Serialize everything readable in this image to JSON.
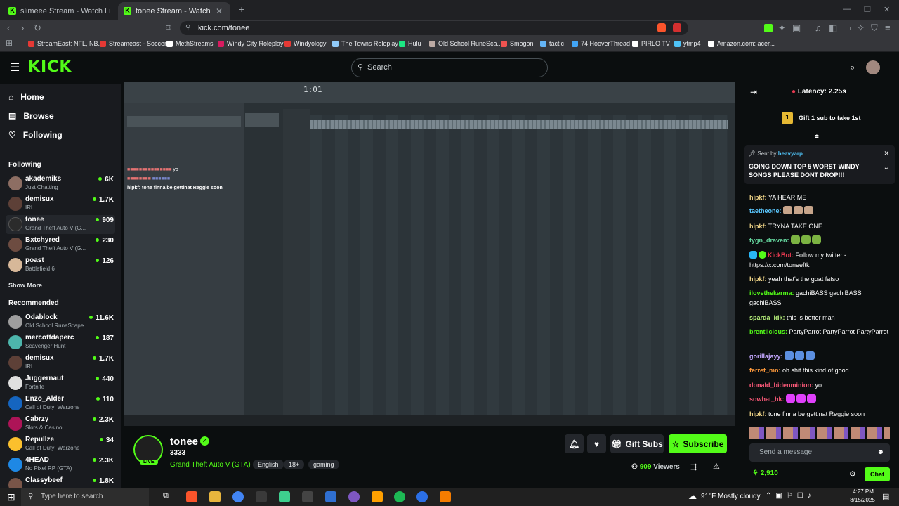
{
  "browser": {
    "tabs": [
      {
        "title": "slimeee Stream - Watch Live on Kick",
        "active": false
      },
      {
        "title": "tonee Stream - Watch Live on Kick",
        "active": true
      }
    ],
    "url": "kick.com/tonee",
    "bookmarks": [
      {
        "label": "StreamEast: NFL, NB...",
        "color": "#e53935"
      },
      {
        "label": "Streameast - Soccer",
        "color": "#e53935"
      },
      {
        "label": "MethStreams",
        "color": "#ffffff"
      },
      {
        "label": "Windy City Roleplay",
        "color": "#d81b60"
      },
      {
        "label": "Windyology",
        "color": "#e53935"
      },
      {
        "label": "The Towns Roleplay",
        "color": "#90caf9"
      },
      {
        "label": "Hulu",
        "color": "#1ce783"
      },
      {
        "label": "Old School RuneSca...",
        "color": "#bcaaa4"
      },
      {
        "label": "Smogon",
        "color": "#ef5350"
      },
      {
        "label": "tactic",
        "color": "#64b5f6"
      },
      {
        "label": "74 HooverThread",
        "color": "#42a5f5"
      },
      {
        "label": "PIRLO TV",
        "color": "#ffffff"
      },
      {
        "label": "ytmp4",
        "color": "#4fc3f7"
      },
      {
        "label": "Amazon.com: acer...",
        "color": "#ffffff"
      }
    ]
  },
  "header": {
    "logo": "KICK",
    "search_placeholder": "Search"
  },
  "sidebar": {
    "nav": [
      {
        "label": "Home",
        "icon": "home-icon"
      },
      {
        "label": "Browse",
        "icon": "browse-icon"
      },
      {
        "label": "Following",
        "icon": "heart-icon"
      }
    ],
    "following_title": "Following",
    "following": [
      {
        "name": "akademiks",
        "game": "Just Chatting",
        "viewers": "6K",
        "color": "#8d6e63"
      },
      {
        "name": "demisux",
        "game": "IRL",
        "viewers": "1.7K",
        "color": "#5d4037"
      },
      {
        "name": "tonee",
        "game": "Grand Theft Auto V (G...",
        "viewers": "909",
        "color": "#2b2b2b"
      },
      {
        "name": "Bxtchyred",
        "game": "Grand Theft Auto V (G...",
        "viewers": "230",
        "color": "#6d4c41"
      },
      {
        "name": "poast",
        "game": "Battlefield 6",
        "viewers": "126",
        "color": "#d7b899"
      }
    ],
    "show_more": "Show More",
    "recommended_title": "Recommended",
    "recommended": [
      {
        "name": "Odablock",
        "game": "Old School RuneScape",
        "viewers": "11.6K",
        "color": "#9e9e9e"
      },
      {
        "name": "mercoffdaperc",
        "game": "Scavenger Hunt",
        "viewers": "187",
        "color": "#4db6ac"
      },
      {
        "name": "demisux",
        "game": "IRL",
        "viewers": "1.7K",
        "color": "#5d4037"
      },
      {
        "name": "Juggernaut",
        "game": "Fortnite",
        "viewers": "440",
        "color": "#e0e0e0"
      },
      {
        "name": "Enzo_Alder",
        "game": "Call of Duty: Warzone",
        "viewers": "110",
        "color": "#1565c0"
      },
      {
        "name": "Cabrzy",
        "game": "Slots & Casino",
        "viewers": "2.3K",
        "color": "#ad1457"
      },
      {
        "name": "Repullze",
        "game": "Call of Duty: Warzone",
        "viewers": "34",
        "color": "#fbc02d"
      },
      {
        "name": "4HEAD",
        "game": "No Pixel RP (GTA)",
        "viewers": "2.3K",
        "color": "#1e88e5"
      },
      {
        "name": "Classybeef",
        "game": "",
        "viewers": "1.8K",
        "color": "#795548"
      }
    ]
  },
  "video": {
    "overlay_chat": [
      {
        "user": "",
        "text": "yo"
      },
      {
        "user": "",
        "text": ""
      },
      {
        "user": "hipkf:",
        "text": "tone finna be gettinat Reggie soon"
      }
    ]
  },
  "stream": {
    "name": "tonee",
    "live": "LIVE",
    "title": "3333",
    "category": "Grand Theft Auto V (GTA)",
    "tags": [
      "English",
      "18+",
      "gaming"
    ],
    "gift_label": "Gift Subs",
    "subscribe_label": "Subscribe",
    "viewers": "909",
    "viewers_label": "Viewers"
  },
  "chat": {
    "latency": "Latency: 2.25s",
    "gift_count": "1",
    "gift_text": "Gift 1 sub to take 1st",
    "pinned_sent_by": "Sent by",
    "pinned_user": "heavyarp",
    "pinned_text": "GOING DOWN TOP 5 WORST WINDY SONGS PLEASE DONT DROP!!!",
    "messages": [
      {
        "user": "hipkf:",
        "color": "#f5d98a",
        "text": "YA HEAR ME",
        "emotes": 0
      },
      {
        "user": "taetheone:",
        "color": "#5bc8ff",
        "text": "",
        "emotes": 3
      },
      {
        "user": "hipkf:",
        "color": "#f5d98a",
        "text": "TRYNA TAKE ONE",
        "emotes": 0
      },
      {
        "user": "tygn_draven:",
        "color": "#66d9a0",
        "text": "",
        "emotes": 3
      },
      {
        "user": "KickBot:",
        "color": "#e53950",
        "text": "Follow my twitter - https://x.com/toneeftk",
        "emotes": 0
      },
      {
        "user": "hipkf:",
        "color": "#f5d98a",
        "text": "yeah that's the goat fatso",
        "emotes": 0
      },
      {
        "user": "ilovethekarma:",
        "color": "#53fc18",
        "text": "gachiBASS gachiBASS gachiBASS",
        "emotes": 0
      },
      {
        "user": "sparda_ldk:",
        "color": "#b9f27c",
        "text": "this is better man",
        "emotes": 0
      },
      {
        "user": "brentlicious:",
        "color": "#53fc18",
        "text": "PartyParrot PartyParrot PartyParrot",
        "emotes": 0
      },
      {
        "user": "gorillajayy:",
        "color": "#c4a7ff",
        "text": "",
        "emotes": 3
      },
      {
        "user": "ferret_mn:",
        "color": "#ff9a3c",
        "text": "oh shit this kind of good",
        "emotes": 0
      },
      {
        "user": "donald_bidenminion:",
        "color": "#ff5a7a",
        "text": "yo",
        "emotes": 0
      },
      {
        "user": "sowhat_hk:",
        "color": "#ff5a7a",
        "text": "",
        "emotes": 3
      },
      {
        "user": "hipkf:",
        "color": "#f5d98a",
        "text": "tone finna be gettinat Reggie soon",
        "emotes": 0
      }
    ],
    "input_placeholder": "Send a message",
    "points": "2,910",
    "chat_button": "Chat"
  },
  "taskbar": {
    "search_placeholder": "Type here to search",
    "weather": "91°F  Mostly cloudy",
    "time": "4:27 PM",
    "date": "8/15/2025"
  }
}
